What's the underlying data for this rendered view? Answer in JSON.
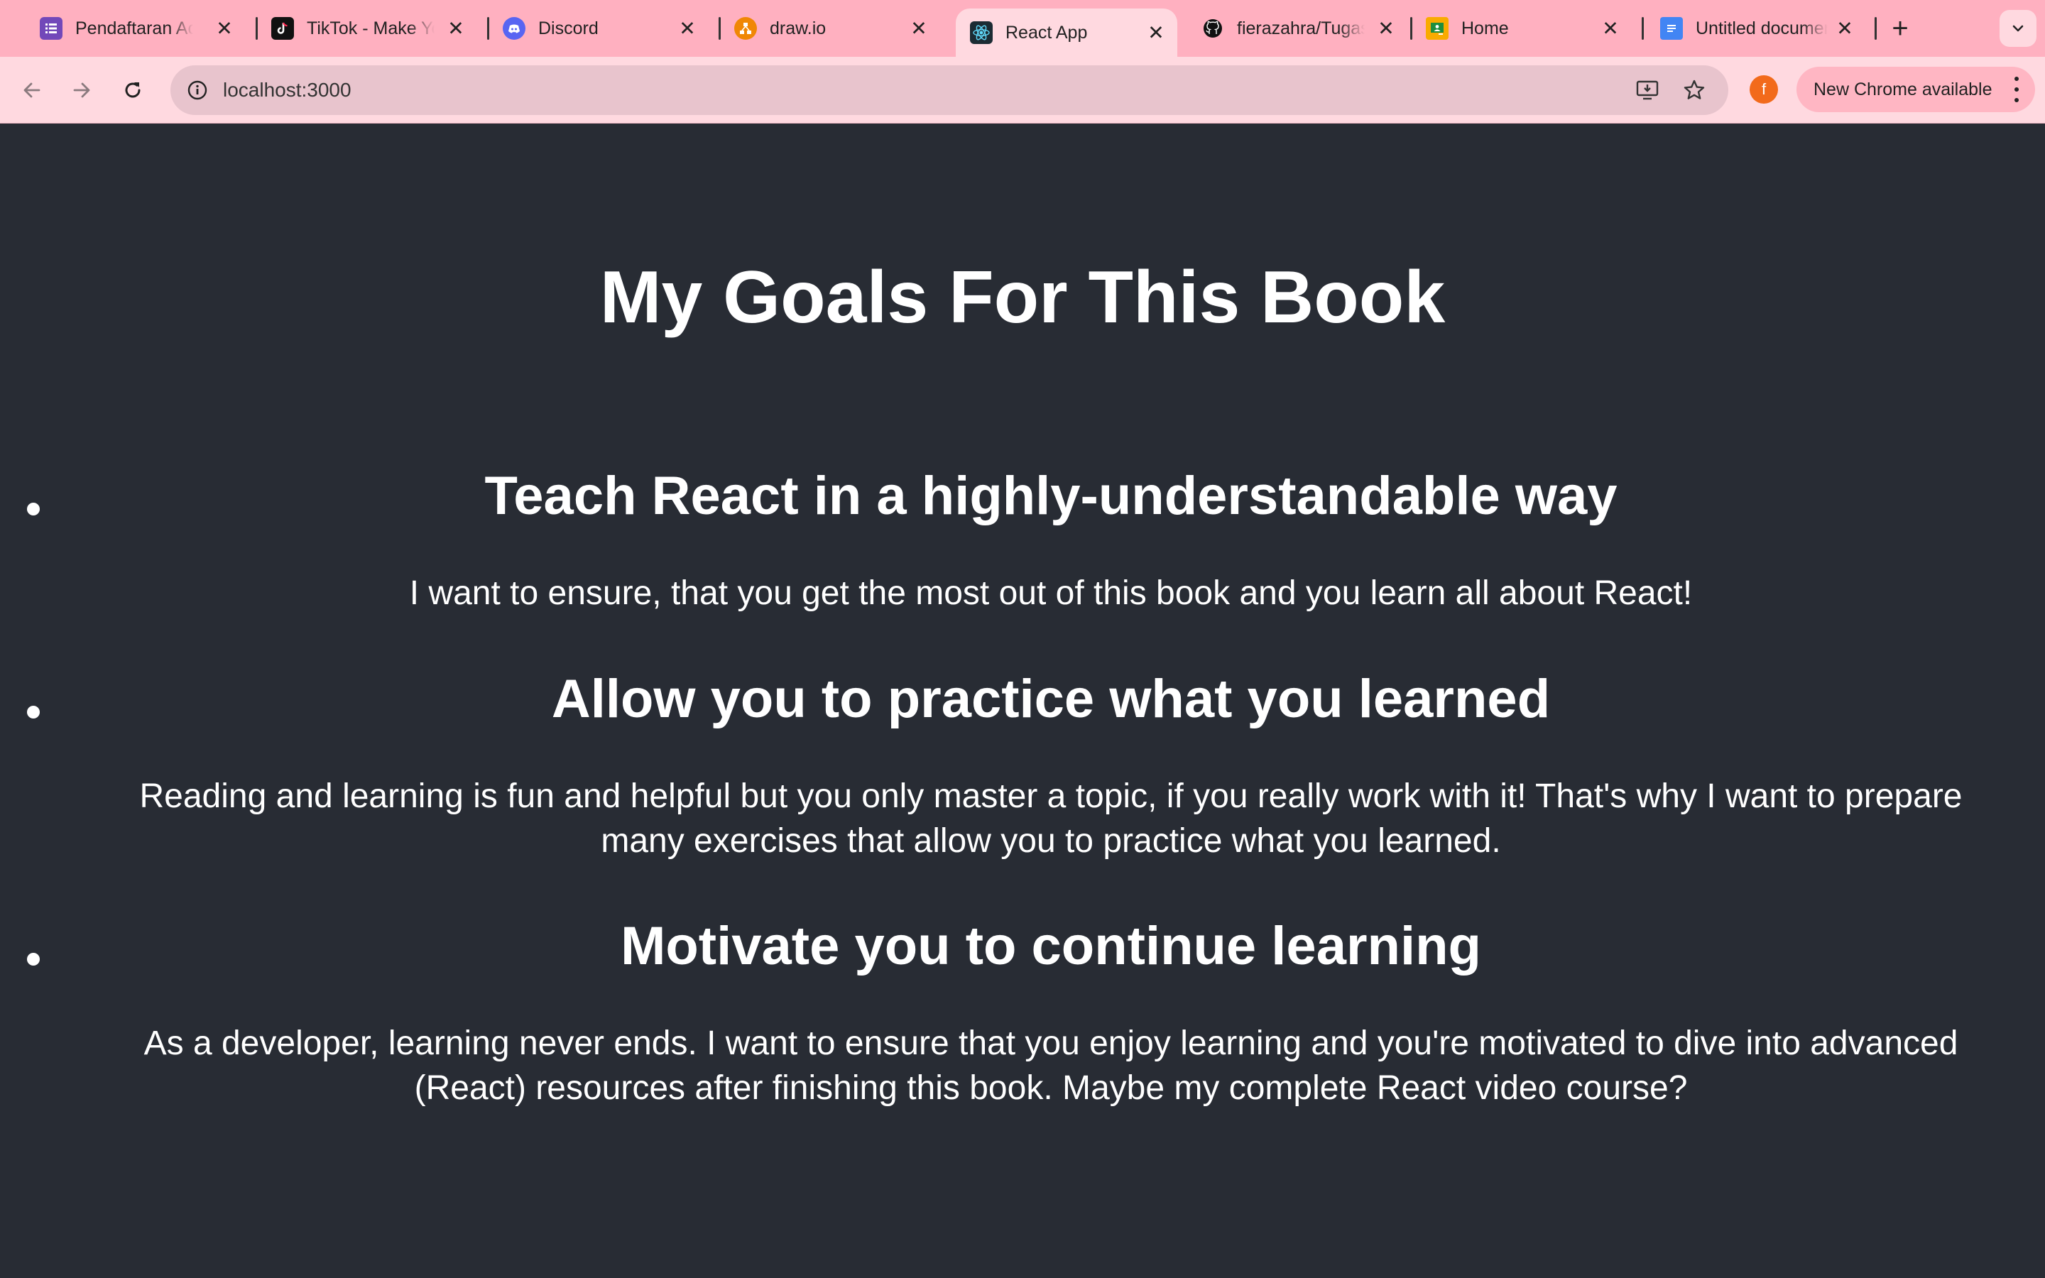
{
  "browser": {
    "tabs": [
      {
        "title": "Pendaftaran Acara",
        "favicon": "forms-icon",
        "color": "#7248b9"
      },
      {
        "title": "TikTok - Make Your Day",
        "favicon": "tiktok-icon",
        "color": "#111111"
      },
      {
        "title": "Discord",
        "favicon": "discord-icon",
        "color": "#5865f2"
      },
      {
        "title": "draw.io",
        "favicon": "drawio-icon",
        "color": "#f08705"
      },
      {
        "title": "React App",
        "favicon": "react-icon",
        "color": "#61dafb",
        "active": true
      },
      {
        "title": "fierazahra/Tugas",
        "favicon": "github-icon",
        "color": "#111111"
      },
      {
        "title": "Home",
        "favicon": "classroom-icon",
        "color": "#f9ab00"
      },
      {
        "title": "Untitled document",
        "favicon": "docs-icon",
        "color": "#4285f4"
      }
    ],
    "tab_close_glyph": "✕",
    "new_tab_glyph": "+",
    "address": "localhost:3000",
    "profile_initial": "f",
    "update_label": "New Chrome available",
    "colors": {
      "tabstrip": "#ffb0c0",
      "toolbar": "#ffd9e0",
      "omnibox": "#e8c4cd",
      "profile": "#f26a1b"
    }
  },
  "page": {
    "background": "#282c34",
    "title": "My Goals For This Book",
    "goals": [
      {
        "title": "Teach React in a highly-understandable way",
        "description_lines": [
          "I want to ensure, that you get the most out of this book and you learn all about React!"
        ]
      },
      {
        "title": "Allow you to practice what you learned",
        "description_lines": [
          "Reading and learning is fun and helpful but you only master a topic, if you really work with it! That's why I want to prepare",
          "many exercises that allow you to practice what you learned."
        ]
      },
      {
        "title": "Motivate you to continue learning",
        "description_lines": [
          "As a developer, learning never ends. I want to ensure that you enjoy learning and you're motivated to dive into advanced",
          "(React) resources after finishing this book. Maybe my complete React video course?"
        ]
      }
    ]
  }
}
